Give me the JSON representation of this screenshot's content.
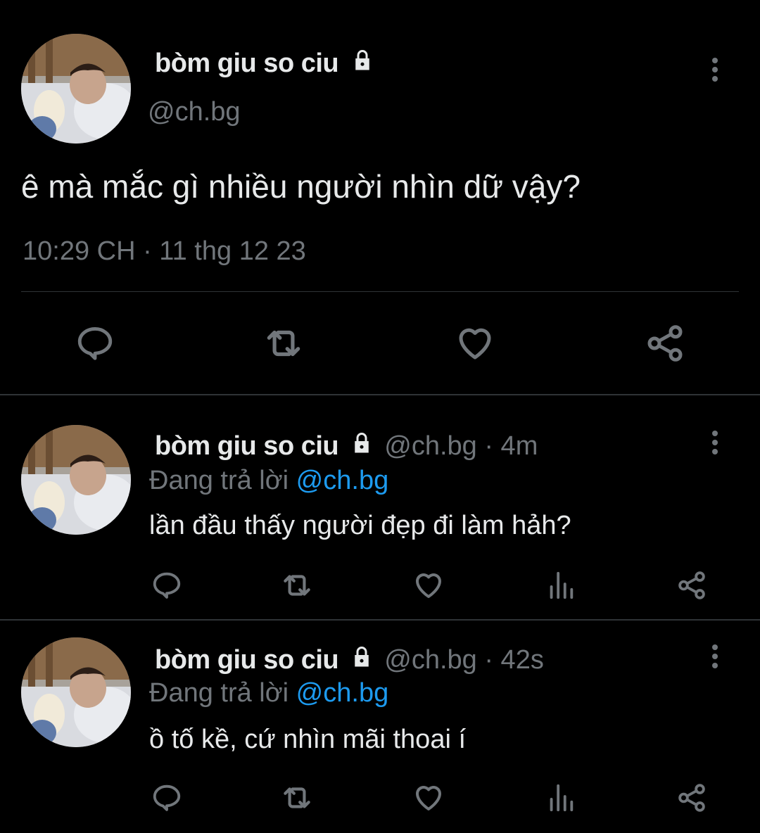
{
  "main_tweet": {
    "display_name": "bòm giu so ciu",
    "handle": "@ch.bg",
    "text": "ê mà mắc gì nhiều người nhìn dữ vậy?",
    "timestamp": "10:29 CH · 11 thg 12 23",
    "actions": [
      "reply-icon",
      "retweet-icon",
      "like-icon",
      "share-icon"
    ]
  },
  "replies": [
    {
      "display_name": "bòm giu so ciu",
      "meta": "@ch.bg · 4m",
      "replying_prefix": "Đang trả lời",
      "replying_to": "@ch.bg",
      "text": "lần đầu thấy người đẹp đi làm hảh?"
    },
    {
      "display_name": "bòm giu so ciu",
      "meta": "@ch.bg · 42s",
      "replying_prefix": "Đang trả lời",
      "replying_to": "@ch.bg",
      "text": "ồ tố kề, cứ nhìn mãi thoai í"
    }
  ],
  "colors": {
    "background": "#000000",
    "text": "#e7e9ea",
    "muted": "#71767b",
    "link": "#1d9bf0",
    "divider": "#2f3336"
  }
}
